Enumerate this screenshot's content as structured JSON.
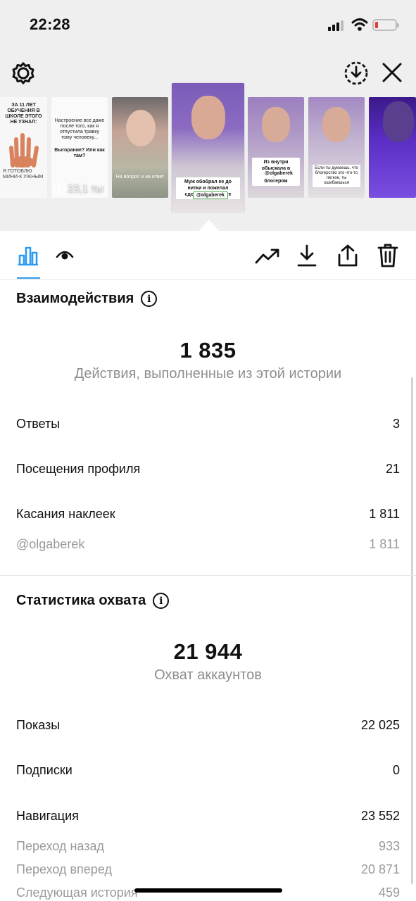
{
  "status_bar": {
    "time": "22:28"
  },
  "stories": [
    {
      "id": "s1",
      "text": "ЗА 11 ЛЕТ ОБУЧЕНИЯ В ШКОЛЕ ЭТОГО НЕ УЗНАЛ:",
      "bottom": "Я ГОТОВЛЮ МИНИ-К УЖНЫМ"
    },
    {
      "id": "s2",
      "text": "Настроение все даже после того, как я отпустила травку тому человеку...",
      "text2": "Выгорание? Или как там?",
      "views": "23,1 ты"
    },
    {
      "id": "s3",
      "text": "На вопрос и на ответ"
    },
    {
      "id": "s4",
      "caption": "Муж обобрал ее до нитки и пожелал сдохнуть в нищете",
      "tag": "@olgaberek"
    },
    {
      "id": "s5",
      "caption": "Из внутри обыскала в нищу-бесс блогером",
      "tag": "@olgaberek"
    },
    {
      "id": "s6",
      "caption": "Если ты думаешь, что блогерство это что-то легкое, ты ошибаешься"
    },
    {
      "id": "s7"
    }
  ],
  "interactions": {
    "title": "Взаимодействия",
    "total": "1 835",
    "total_label": "Действия, выполненные из этой истории",
    "rows": [
      {
        "label": "Ответы",
        "value": "3"
      },
      {
        "label": "Посещения профиля",
        "value": "21"
      },
      {
        "label": "Касания наклеек",
        "value": "1 811"
      }
    ],
    "sub_row": {
      "label": "@olgaberek",
      "value": "1 811"
    }
  },
  "reach": {
    "title": "Статистика охвата",
    "total": "21 944",
    "total_label": "Охват аккаунтов",
    "rows": [
      {
        "label": "Показы",
        "value": "22 025"
      },
      {
        "label": "Подписки",
        "value": "0"
      },
      {
        "label": "Навигация",
        "value": "23 552"
      }
    ],
    "sub_rows": [
      {
        "label": "Переход назад",
        "value": "933"
      },
      {
        "label": "Переход вперед",
        "value": "20 871"
      },
      {
        "label": "Следующая история",
        "value": "459"
      }
    ]
  },
  "colors": {
    "accent": "#2e9bf0",
    "muted": "#8e8e8e",
    "purple": "#6e45c9"
  },
  "icons": [
    "settings-gear-icon",
    "download-circle-icon",
    "close-icon",
    "bar-chart-icon",
    "eye-icon",
    "trending-icon",
    "download-icon",
    "share-icon",
    "trash-icon",
    "info-icon"
  ]
}
